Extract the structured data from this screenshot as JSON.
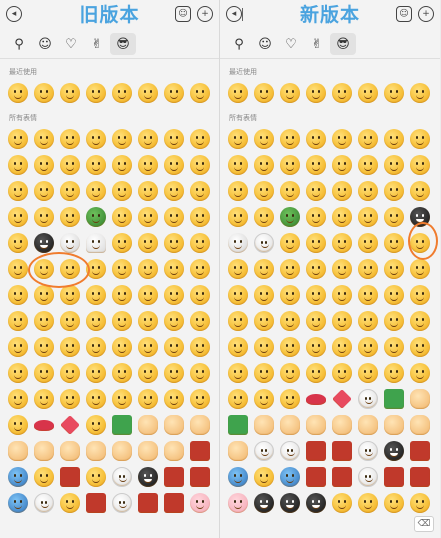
{
  "left": {
    "title": "旧版本",
    "recent_label": "最近使用",
    "all_label": "所有表情"
  },
  "right": {
    "title": "新版本",
    "recent_label": "最近使用",
    "all_label": "所有表情"
  },
  "tabs": [
    "search-icon",
    "smile-face-icon",
    "heart-icon",
    "gesture-icon",
    "emoji-pack-icon"
  ],
  "icons": {
    "voice": "voice-icon",
    "emoji_keyboard": "emoji-keyboard-icon",
    "add": "plus-icon",
    "delete": "delete-icon"
  },
  "annotation_color": "#f07c2e",
  "title_color": "#4aa3df"
}
